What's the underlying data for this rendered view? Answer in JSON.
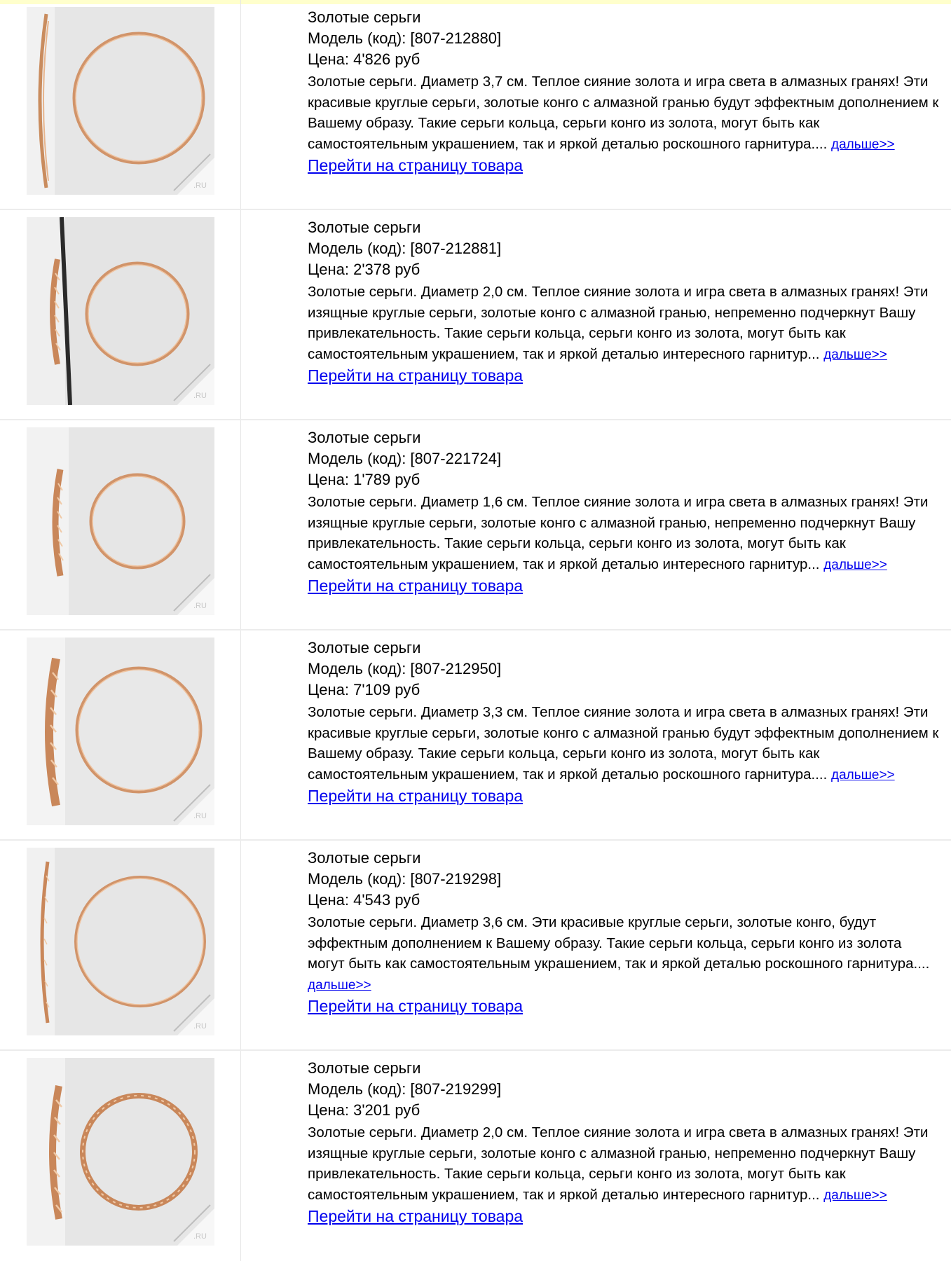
{
  "products": [
    {
      "title": "Золотые серьги",
      "model": "Модель (код): [807-212880]",
      "price": "Цена: 4'826 руб",
      "description": "Золотые серьги. Диаметр 3,7 см. Теплое сияние золота и игра света в алмазных гранях! Эти красивые круглые серьги, золотые конго с алмазной гранью будут эффектным дополнением к Вашему образу. Такие серьги кольца, серьги конго из золота, могут быть как самостоятельным украшением, так и яркой деталью роскошного гарнитура....",
      "more_link": "дальше>>",
      "page_link": "Перейти на страницу товара",
      "watermark": "GOLDOTOTO.RU"
    },
    {
      "title": "Золотые серьги",
      "model": "Модель (код): [807-212881]",
      "price": "Цена: 2'378 руб",
      "description": "Золотые серьги. Диаметр 2,0 см. Теплое сияние золота и игра света в алмазных гранях! Эти изящные круглые серьги, золотые конго с алмазной гранью, непременно подчеркнут Вашу привлекательность. Такие серьги кольца, серьги конго из золота, могут быть как самостоятельным украшением, так и яркой деталью интересного гарнитур...",
      "more_link": "дальше>>",
      "page_link": "Перейти на страницу товара",
      "watermark": "GOLDOTOTO.RU"
    },
    {
      "title": "Золотые серьги",
      "model": "Модель (код): [807-221724]",
      "price": "Цена: 1'789 руб",
      "description": "Золотые серьги. Диаметр 1,6 см. Теплое сияние золота и игра света в алмазных гранях! Эти изящные круглые серьги, золотые конго с алмазной гранью, непременно подчеркнут Вашу привлекательность. Такие серьги кольца, серьги конго из золота, могут быть как самостоятельным украшением, так и яркой деталью интересного гарнитур...",
      "more_link": "дальше>>",
      "page_link": "Перейти на страницу товара",
      "watermark": "GOLDOTOTO.RU"
    },
    {
      "title": "Золотые серьги",
      "model": "Модель (код): [807-212950]",
      "price": "Цена: 7'109 руб",
      "description": "Золотые серьги. Диаметр 3,3 см. Теплое сияние золота и игра света в алмазных гранях! Эти красивые круглые серьги, золотые конго с алмазной гранью будут эффектным дополнением к Вашему образу. Такие серьги кольца, серьги конго из золота, могут быть как самостоятельным украшением, так и яркой деталью роскошного гарнитура....",
      "more_link": "дальше>>",
      "page_link": "Перейти на страницу товара",
      "watermark": "GOLDOTOTO.RU"
    },
    {
      "title": "Золотые серьги",
      "model": "Модель (код): [807-219298]",
      "price": "Цена: 4'543 руб",
      "description": "Золотые серьги. Диаметр 3,6 см. Эти красивые круглые серьги, золотые конго, будут эффектным дополнением к Вашему образу. Такие серьги кольца, серьги конго из золота могут быть как самостоятельным украшением, так и яркой деталью роскошного гарнитура....",
      "more_link": "дальше>>",
      "page_link": "Перейти на страницу товара",
      "watermark": "GOLDOTOTO.RU"
    },
    {
      "title": "Золотые серьги",
      "model": "Модель (код): [807-219299]",
      "price": "Цена: 3'201 руб",
      "description": "Золотые серьги. Диаметр 2,0 см. Теплое сияние золота и игра света в алмазных гранях! Эти изящные круглые серьги, золотые конго с алмазной гранью, непременно подчеркнут Вашу привлекательность. Такие серьги кольца, серьги конго из золота, могут быть как самостоятельным украшением, так и яркой деталью интересного гарнитур...",
      "more_link": "дальше>>",
      "page_link": "Перейти на страницу товара",
      "watermark": "GOLDOTOTO.RU"
    }
  ],
  "colors": {
    "top_strip": "#ffffcc",
    "link": "#0000ee",
    "gold": "#d89a6a",
    "photo_bg": "#e7e7e7"
  }
}
